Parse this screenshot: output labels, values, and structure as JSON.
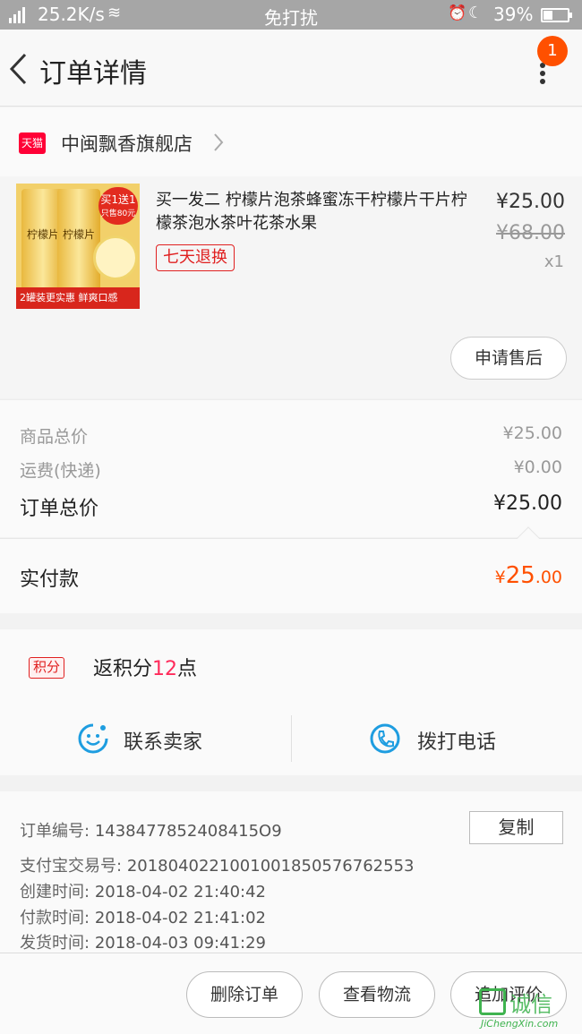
{
  "status_bar": {
    "speed": "25.2K/s",
    "mode": "免打扰",
    "battery": "39%"
  },
  "nav": {
    "title": "订单详情",
    "badge": "1"
  },
  "shop": {
    "tmall_label": "天猫",
    "name": "中闽飘香旗舰店"
  },
  "item": {
    "title": "买一发二 柠檬片泡茶蜂蜜冻干柠檬片干片柠檬茶泡水茶叶花茶水果",
    "tag": "七天退换",
    "price": "¥25.00",
    "original_price": "¥68.00",
    "quantity": "x1",
    "after_sale_button": "申请售后",
    "image_text": {
      "can": "柠檬片",
      "promo_line1": "买1送1",
      "promo_line2": "只售80元",
      "strip": "2罐装更实惠 鲜爽口感"
    }
  },
  "totals": {
    "goods_label": "商品总价",
    "goods_value": "¥25.00",
    "shipping_label": "运费(快递)",
    "shipping_value": "¥0.00",
    "order_label": "订单总价",
    "order_value": "¥25.00",
    "paid_label": "实付款",
    "paid_symbol": "¥",
    "paid_int": "25",
    "paid_dec": ".00"
  },
  "points": {
    "tag": "积分",
    "text_prefix": "返积分",
    "number": "12",
    "text_suffix": "点"
  },
  "contact": {
    "seller": "联系卖家",
    "phone": "拨打电话"
  },
  "order_info": {
    "order_no_label": "订单编号:",
    "order_no": "1438477852408415O9",
    "alipay_label": "支付宝交易号:",
    "alipay_no": "2018040221001001850576762553",
    "created_label": "创建时间:",
    "created": "2018-04-02 21:40:42",
    "paid_label": "付款时间:",
    "paid": "2018-04-02 21:41:02",
    "shipped_label": "发货时间:",
    "shipped": "2018-04-03 09:41:29",
    "copy_button": "复制"
  },
  "actions": {
    "delete": "删除订单",
    "logistics": "查看物流",
    "review": "追加评价"
  },
  "watermark": {
    "brand": "诚信",
    "domain": "JiChengXin.com"
  },
  "colors": {
    "accent": "#ff5000",
    "tmall_red": "#ff0036",
    "tag_red": "#e02020",
    "points_pink": "#ff2a5a",
    "icon_blue": "#1e9de0",
    "watermark_green": "#3fb34f"
  }
}
